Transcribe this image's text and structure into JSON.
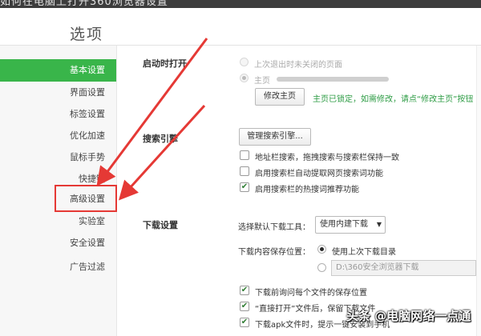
{
  "topbar": {
    "text": "如何在电脑上打开360浏览器设置"
  },
  "title": "选项",
  "sidebar": {
    "items": [
      {
        "label": "基本设置",
        "active": true
      },
      {
        "label": "界面设置"
      },
      {
        "label": "标签设置"
      },
      {
        "label": "优化加速"
      },
      {
        "label": "鼠标手势"
      },
      {
        "label": "快捷键"
      },
      {
        "label": "高级设置",
        "highlighted": true
      },
      {
        "label": "实验室"
      },
      {
        "label": "安全设置"
      },
      {
        "label": "广告过滤"
      }
    ]
  },
  "startup": {
    "label": "启动时打开",
    "option_last": "上次退出时未关闭的页面",
    "option_home": "主页",
    "change_home_button": "修改主页",
    "locked_note": "主页已锁定，如需修改，请点“修改主页”按钮"
  },
  "search": {
    "label": "搜索引擎",
    "manage_button": "管理搜索引擎...",
    "opt_address_bar": "地址栏搜索，拖拽搜索与搜索栏保持一致",
    "opt_auto_extract": "启用搜索栏自动提取网页搜索词功能",
    "opt_hot_words": "启用搜索栏的热搜词推荐功能"
  },
  "download": {
    "label": "下载设置",
    "tool_label": "选择默认下载工具：",
    "tool_value": "使用内建下载",
    "save_location_label": "下载内容保存位置：",
    "use_last_dir": "使用上次下载目录",
    "custom_path": "D:\\360安全浏览器下载",
    "ask_each_file": "下载前询问每个文件的保存位置",
    "direct_open": "“直接打开”文件后，保留下载文件",
    "apk_prompt": "下载apk文件时，提示一键安装到手机"
  },
  "watermark": "头条 @电脑网络一点通",
  "colors": {
    "active_nav": "#39b54a",
    "highlight_box": "#e53935",
    "arrow": "#e53935",
    "note_green": "#2e9c45"
  }
}
